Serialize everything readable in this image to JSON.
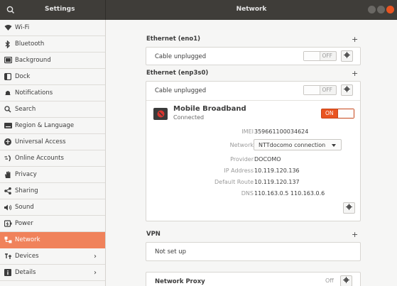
{
  "header": {
    "left_title": "Settings",
    "center_title": "Network",
    "search_icon": "search-icon",
    "window_buttons": [
      "minimize-icon",
      "maximize-icon",
      "close-icon"
    ]
  },
  "sidebar": {
    "items": [
      {
        "label": "Wi-Fi",
        "icon": "wifi-icon"
      },
      {
        "label": "Bluetooth",
        "icon": "bluetooth-icon"
      },
      {
        "label": "Background",
        "icon": "background-icon"
      },
      {
        "label": "Dock",
        "icon": "dock-icon"
      },
      {
        "label": "Notifications",
        "icon": "bell-icon"
      },
      {
        "label": "Search",
        "icon": "search-icon"
      },
      {
        "label": "Region & Language",
        "icon": "keyboard-icon"
      },
      {
        "label": "Universal Access",
        "icon": "accessibility-icon"
      },
      {
        "label": "Online Accounts",
        "icon": "online-accounts-icon"
      },
      {
        "label": "Privacy",
        "icon": "hand-icon"
      },
      {
        "label": "Sharing",
        "icon": "share-icon"
      },
      {
        "label": "Sound",
        "icon": "speaker-icon"
      },
      {
        "label": "Power",
        "icon": "power-icon"
      },
      {
        "label": "Network",
        "icon": "network-icon",
        "active": true
      },
      {
        "label": "Devices",
        "icon": "devices-icon",
        "chevron": true
      },
      {
        "label": "Details",
        "icon": "details-icon",
        "chevron": true
      }
    ]
  },
  "main": {
    "eth1": {
      "title": "Ethernet (eno1)",
      "row": "Cable unplugged",
      "toggle": "OFF",
      "add": "+"
    },
    "eth2": {
      "title": "Ethernet (enp3s0)",
      "row": "Cable unplugged",
      "toggle": "OFF",
      "add": "+"
    },
    "mobile": {
      "title": "Mobile Broadband",
      "status": "Connected",
      "toggle": "ON",
      "imei_label": "IMEI",
      "imei_value": "359661100034624",
      "network_label": "Network",
      "network_value": "NTTdocomo connection",
      "provider_label": "Provider",
      "provider_value": "DOCOMO",
      "ip_label": "IP Address",
      "ip_value": "10.119.120.136",
      "route_label": "Default Route",
      "route_value": "10.119.120.137",
      "dns_label": "DNS",
      "dns_value": "110.163.0.5 110.163.0.6"
    },
    "vpn": {
      "title": "VPN",
      "add": "+",
      "row": "Not set up"
    },
    "proxy": {
      "title": "Network Proxy",
      "status": "Off"
    }
  },
  "colors": {
    "accent": "#e95420",
    "active_sidebar": "#f0825b",
    "header_bg": "#3f3d39"
  }
}
